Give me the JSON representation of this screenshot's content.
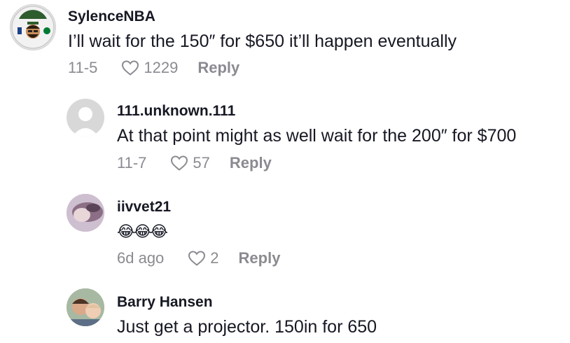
{
  "comments": [
    {
      "username": "SylenceNBA",
      "text": "I’ll wait for the 150″ for $650 it’ll happen eventually",
      "date": "11-5",
      "likes": "1229",
      "reply_label": "Reply",
      "avatar_icon": "cartoon-avatar-icon"
    },
    {
      "username": "111.unknown.111",
      "text": "At that point might as well wait for the 200″ for $700",
      "date": "11-7",
      "likes": "57",
      "reply_label": "Reply",
      "avatar_icon": "default-avatar-icon"
    },
    {
      "username": "iivvet21",
      "text": "😂😂😂",
      "date": "6d ago",
      "likes": "2",
      "reply_label": "Reply",
      "avatar_icon": "photo-avatar-icon"
    },
    {
      "username": "Barry Hansen",
      "text": "Just get a projector. 150in for 650",
      "avatar_icon": "photo-avatar-icon"
    }
  ],
  "colors": {
    "text": "#161823",
    "muted": "#8a8b91",
    "avatar_gray": "#d8d8d8"
  }
}
